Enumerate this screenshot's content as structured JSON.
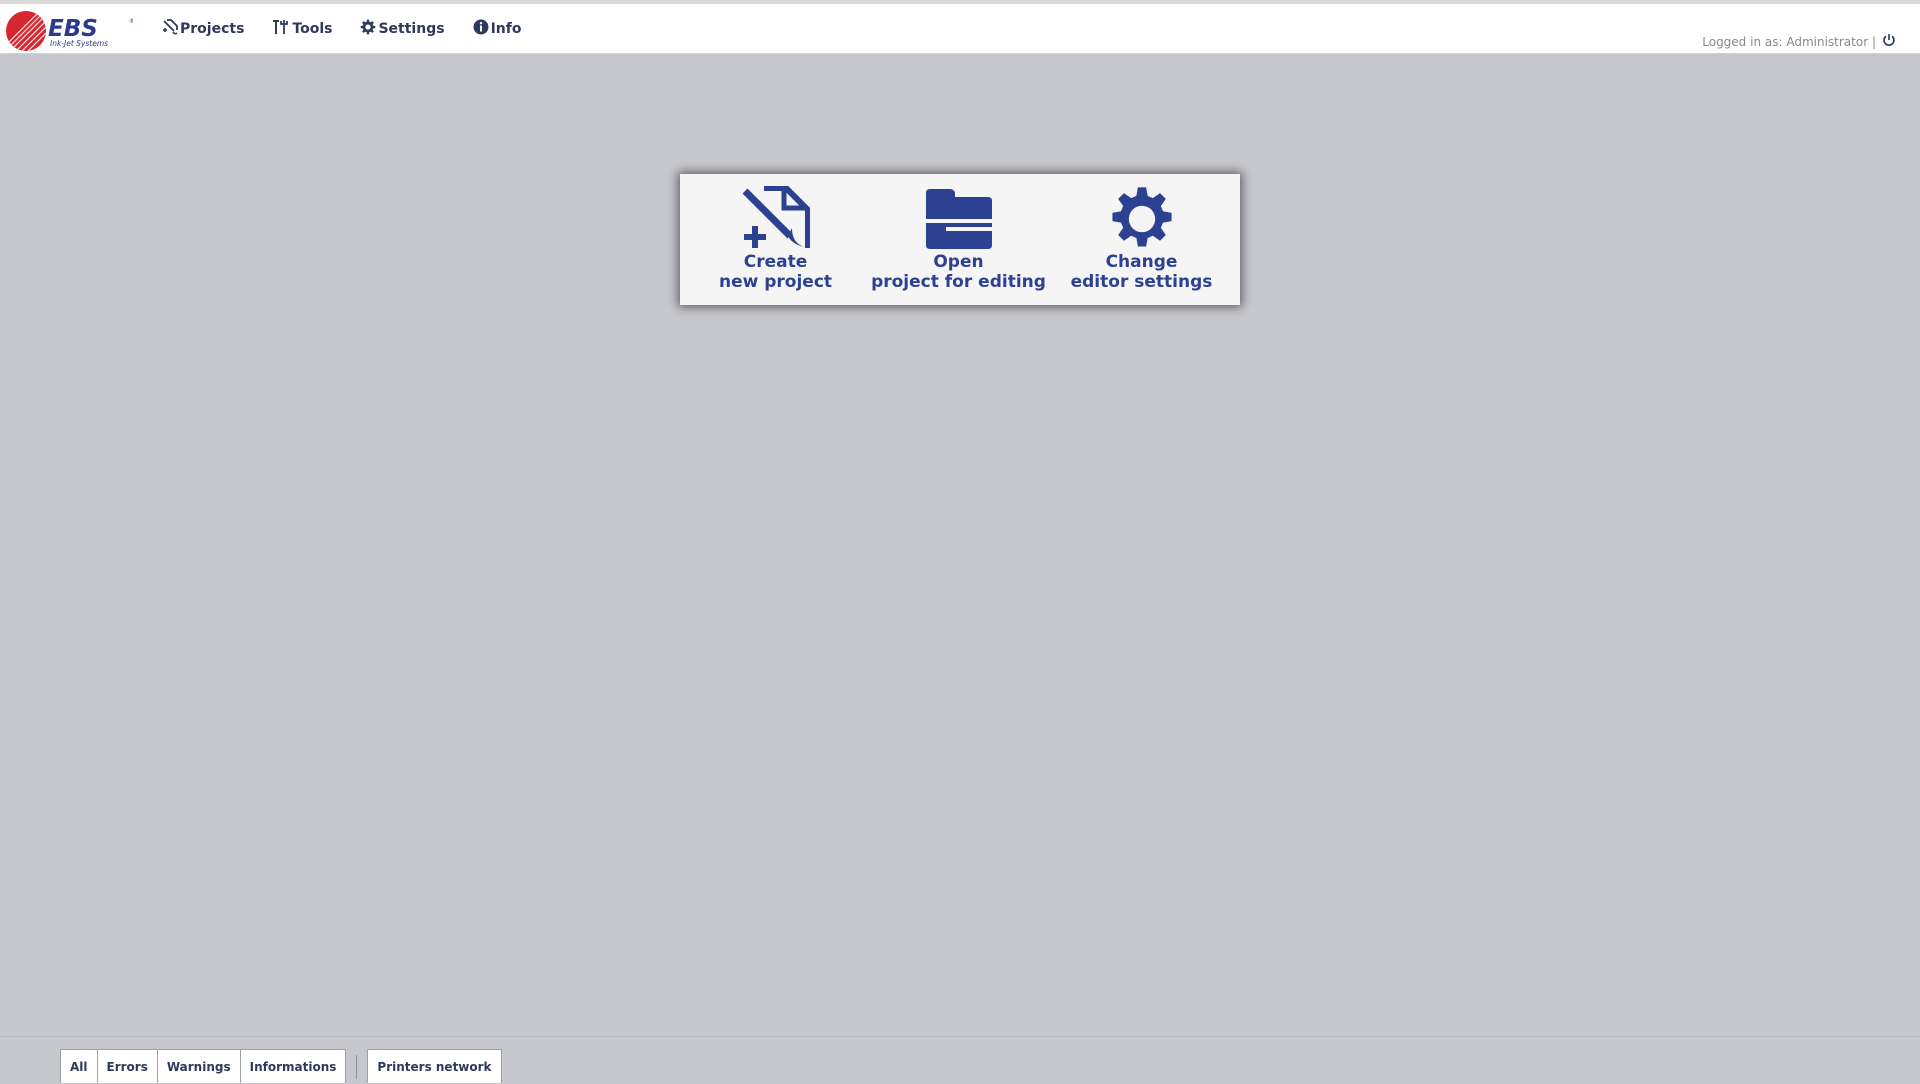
{
  "brand": {
    "name": "EBS",
    "tagline": "Ink-Jet Systems"
  },
  "nav": {
    "projects": "Projects",
    "tools": "Tools",
    "settings": "Settings",
    "info": "Info"
  },
  "user": {
    "login_text": "Logged in as: Administrator |"
  },
  "panel": {
    "create_line1": "Create",
    "create_line2": "new project",
    "open_line1": "Open",
    "open_line2": "project for editing",
    "change_line1": "Change",
    "change_line2": "editor settings"
  },
  "footer": {
    "all": "All",
    "errors": "Errors",
    "warnings": "Warnings",
    "informations": "Informations",
    "printers_network": "Printers network"
  },
  "colors": {
    "accent": "#2d4192",
    "nav_text": "#2d3a5c",
    "background": "#c7c8cd",
    "logo_red": "#d8262e"
  },
  "icons": {
    "projects": "pen-ruler-icon",
    "tools": "tools-icon",
    "settings": "gear-icon",
    "info": "info-icon",
    "power": "power-icon",
    "create": "new-project-icon",
    "open": "folder-icon",
    "change": "gear-icon"
  }
}
